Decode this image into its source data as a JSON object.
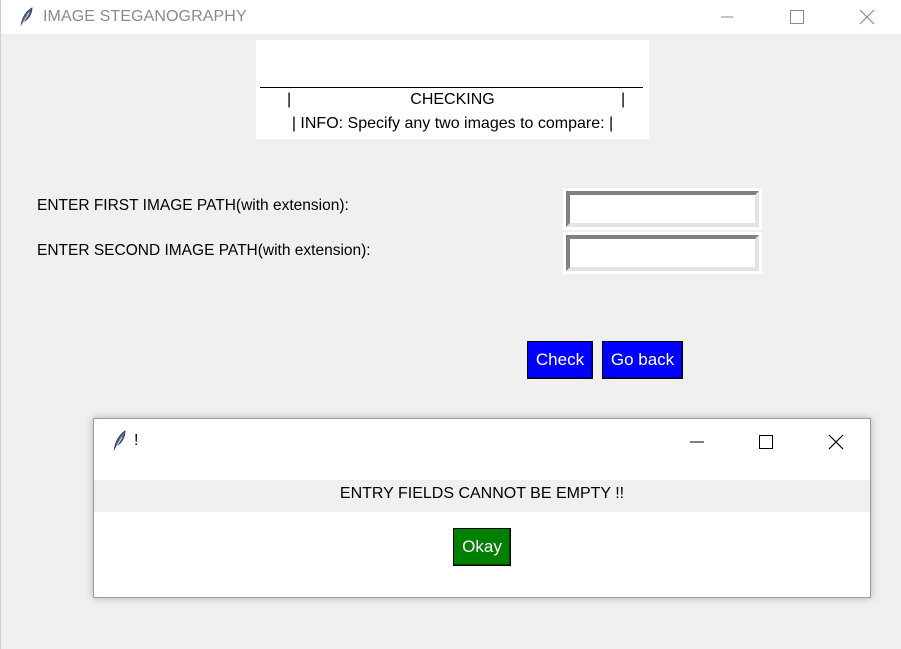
{
  "main_window": {
    "title": "IMAGE STEGANOGRAPHY",
    "header": {
      "pipe_left": "|",
      "title": "CHECKING",
      "pipe_right": "|",
      "info": "| INFO: Specify any two images to compare: |"
    },
    "form": {
      "first_label": "ENTER FIRST IMAGE PATH(with extension):",
      "first_value": "",
      "second_label": "ENTER SECOND IMAGE PATH(with extension):",
      "second_value": ""
    },
    "buttons": {
      "check": "Check",
      "go_back": "Go back"
    }
  },
  "dialog": {
    "title": "!",
    "message": "ENTRY FIELDS CANNOT BE EMPTY !!",
    "okay": "Okay"
  },
  "icons": [
    "feather-icon",
    "minimize-icon",
    "maximize-icon",
    "close-icon"
  ],
  "colors": {
    "button_blue": "#0000ff",
    "button_green": "#008000",
    "window_bg": "#f0f0f0"
  }
}
